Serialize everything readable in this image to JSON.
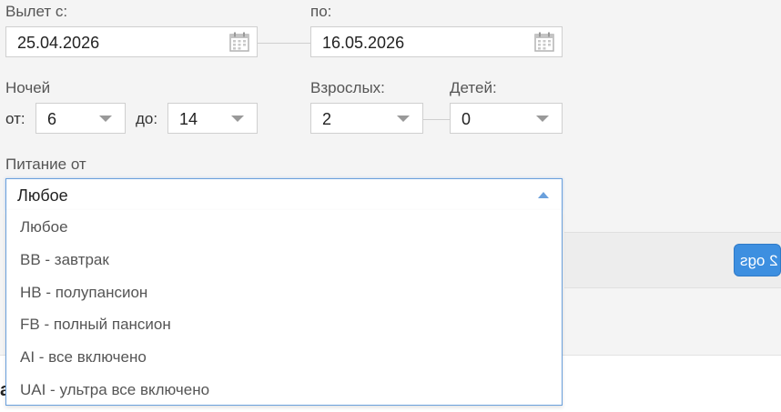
{
  "dates": {
    "from_label": "Вылет с:",
    "from_value": "25.04.2026",
    "to_label": "по:",
    "to_value": "16.05.2026"
  },
  "nights": {
    "label": "Ночей",
    "from_label": "от:",
    "from_value": "6",
    "to_label": "до:",
    "to_value": "14"
  },
  "guests": {
    "adults_label": "Взрослых:",
    "adults_value": "2",
    "children_label": "Детей:",
    "children_value": "0"
  },
  "meal": {
    "label": "Питание от",
    "selected": "Любое",
    "options": [
      "Любое",
      "BB - завтрак",
      "HB - полупансион",
      "FB - полный пансион",
      "AI - все включено",
      "UAI - ультра все включено"
    ]
  },
  "badge": {
    "text": "2 ogs"
  },
  "bottom": {
    "cut_text": "а"
  },
  "colors": {
    "accent": "#3d8fe0",
    "focus_border": "#6aa0dc",
    "field_border": "#cfcfcf",
    "background": "#f4f4f4"
  }
}
